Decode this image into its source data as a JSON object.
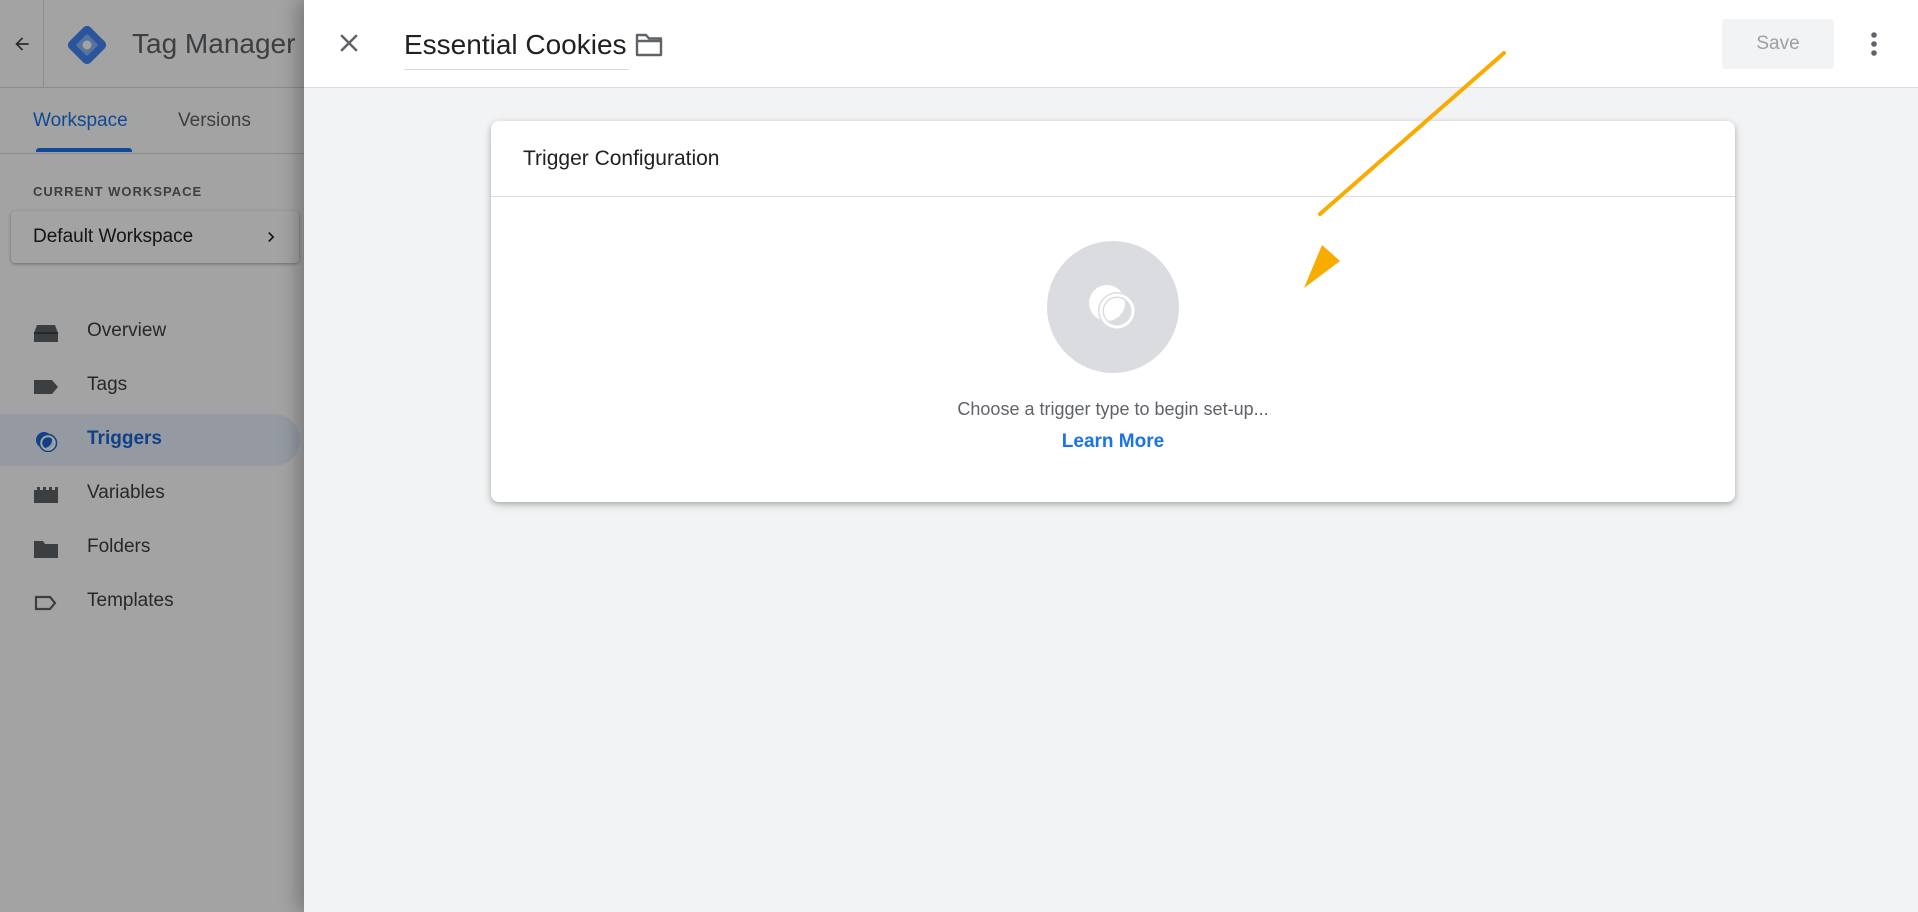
{
  "app": {
    "product_name": "Tag Manager",
    "tabs": [
      {
        "label": "Workspace",
        "active": true
      },
      {
        "label": "Versions",
        "active": false
      }
    ],
    "current_workspace_label": "CURRENT WORKSPACE",
    "workspace_name": "Default Workspace",
    "nav": [
      {
        "label": "Overview",
        "icon": "overview-icon",
        "active": false
      },
      {
        "label": "Tags",
        "icon": "tag-icon",
        "active": false
      },
      {
        "label": "Triggers",
        "icon": "trigger-icon",
        "active": true
      },
      {
        "label": "Variables",
        "icon": "variables-icon",
        "active": false
      },
      {
        "label": "Folders",
        "icon": "folder-icon",
        "active": false
      },
      {
        "label": "Templates",
        "icon": "template-icon",
        "active": false
      }
    ]
  },
  "editor": {
    "title": "Essential Cookies",
    "save_label": "Save",
    "card": {
      "title": "Trigger Configuration",
      "prompt": "Choose a trigger type to begin set-up...",
      "learn_more": "Learn More"
    }
  },
  "colors": {
    "accent": "#1a73e8",
    "annotation_arrow": "#f9ab00"
  }
}
